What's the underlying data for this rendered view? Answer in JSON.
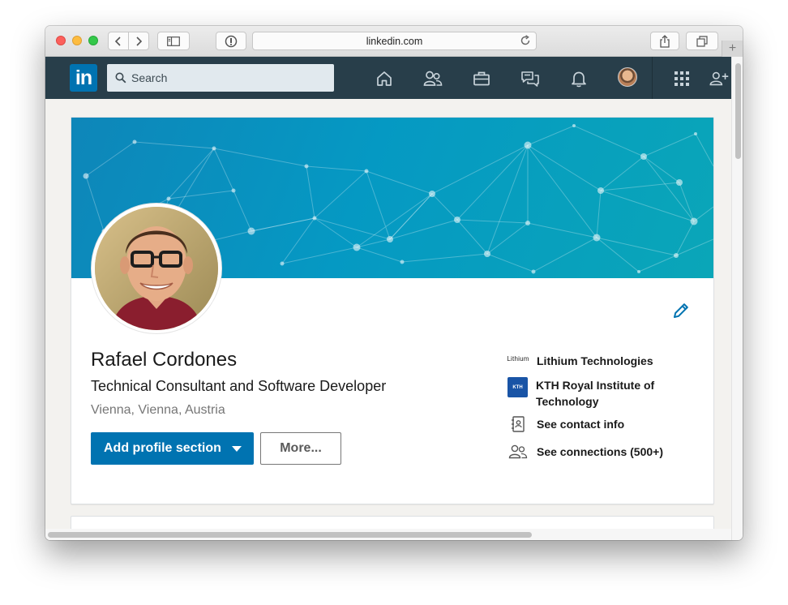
{
  "browser": {
    "url": "linkedin.com",
    "icons": [
      "back-icon",
      "forward-icon",
      "sidebar-icon",
      "reader-icon",
      "reload-icon",
      "share-icon",
      "tabs-icon",
      "add-tab-icon"
    ],
    "add_tab": "+"
  },
  "nav": {
    "logo": "in",
    "search_placeholder": "Search",
    "icons": [
      "home-icon",
      "network-icon",
      "jobs-icon",
      "messaging-icon",
      "notifications-icon",
      "apps-grid-icon",
      "add-person-icon"
    ]
  },
  "profile": {
    "name": "Rafael Cordones",
    "headline": "Technical Consultant and Software Developer",
    "location": "Vienna, Vienna, Austria",
    "add_section_label": "Add profile section",
    "more_label": "More...",
    "sidebar": [
      {
        "logo": "Lithium",
        "label": "Lithium Technologies"
      },
      {
        "logo": "KTH",
        "label": "KTH Royal Institute of Technology"
      },
      {
        "label": "See contact info"
      },
      {
        "label": "See connections (500+)"
      }
    ]
  },
  "colors": {
    "nav_bg": "#283e4a",
    "brand_blue": "#0073b1",
    "banner_start": "#0e86b9",
    "banner_end": "#0aa6b8"
  }
}
